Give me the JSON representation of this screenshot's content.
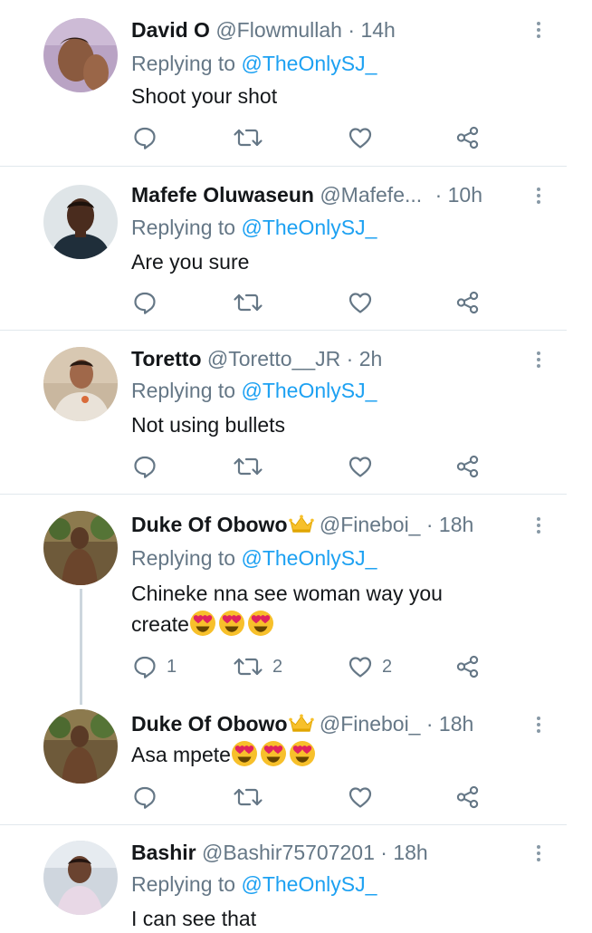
{
  "tweets": [
    {
      "name": "David O",
      "handle": "@Flowmullah",
      "time": "14h",
      "replying_prefix": "Replying to",
      "replying_to": "@TheOnlySJ_",
      "text": "Shoot your shot",
      "emoji_count": 0,
      "crown": false,
      "counts": {
        "reply": "",
        "retweet": "",
        "like": ""
      }
    },
    {
      "name": "Mafefe Oluwaseun",
      "handle": "@Mafefe...",
      "time": "10h",
      "replying_prefix": "Replying to",
      "replying_to": "@TheOnlySJ_",
      "text": "Are you sure",
      "emoji_count": 0,
      "crown": false,
      "counts": {
        "reply": "",
        "retweet": "",
        "like": ""
      }
    },
    {
      "name": "Toretto",
      "handle": "@Toretto__JR",
      "time": "2h",
      "replying_prefix": "Replying to",
      "replying_to": "@TheOnlySJ_",
      "text": "Not using bullets",
      "emoji_count": 0,
      "crown": false,
      "counts": {
        "reply": "",
        "retweet": "",
        "like": ""
      }
    },
    {
      "name": "Duke Of Obowo",
      "handle": "@Fineboi_",
      "time": "18h",
      "replying_prefix": "Replying to",
      "replying_to": "@TheOnlySJ_",
      "text_line1": "Chineke nna see woman way you",
      "text_line2": "create",
      "emoji_count": 3,
      "crown": true,
      "counts": {
        "reply": "1",
        "retweet": "2",
        "like": "2"
      }
    },
    {
      "name": "Duke Of Obowo",
      "handle": "@Fineboi_",
      "time": "18h",
      "text": "Asa mpete",
      "emoji_count": 3,
      "crown": true,
      "counts": {
        "reply": "",
        "retweet": "",
        "like": ""
      }
    },
    {
      "name": "Bashir",
      "handle": "@Bashir75707201",
      "time": "18h",
      "replying_prefix": "Replying to",
      "replying_to": "@TheOnlySJ_",
      "text": "I can see that",
      "emoji_count": 0,
      "crown": false
    }
  ],
  "separator": "·",
  "icons": {
    "reply": "reply-icon",
    "retweet": "retweet-icon",
    "like": "heart-icon",
    "share": "share-icon",
    "more": "more-vertical-icon",
    "emoji": "heart-eyes-emoji",
    "crown": "crown-emoji"
  },
  "colors": {
    "mention": "#1da1f2",
    "secondary": "#657786",
    "text": "#14171a",
    "divider": "#e1e8ed",
    "thread_line": "#ccd6dd"
  }
}
